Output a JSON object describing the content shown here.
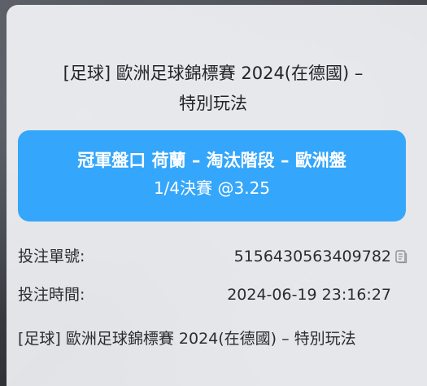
{
  "bet": {
    "title_line1": "[足球]  歐洲足球錦標賽 2024(在德國) –",
    "title_line2": "特別玩法",
    "pick_line1": "冠軍盤口 荷蘭 – 淘汰階段 – 歐洲盤",
    "pick_line2": "1/4決賽 @3.25",
    "id_label": "投注單號:",
    "id_value": "5156430563409782",
    "time_label": "投注時間:",
    "time_value": "2024-06-19 23:16:27",
    "event_text": "[足球] 歐洲足球錦標賽 2024(在德國) – 特別玩法"
  },
  "colors": {
    "accent": "#34a6fb",
    "panel": "#f6f7fb",
    "text": "#232428"
  },
  "icons": {
    "copy": "copy-icon"
  }
}
